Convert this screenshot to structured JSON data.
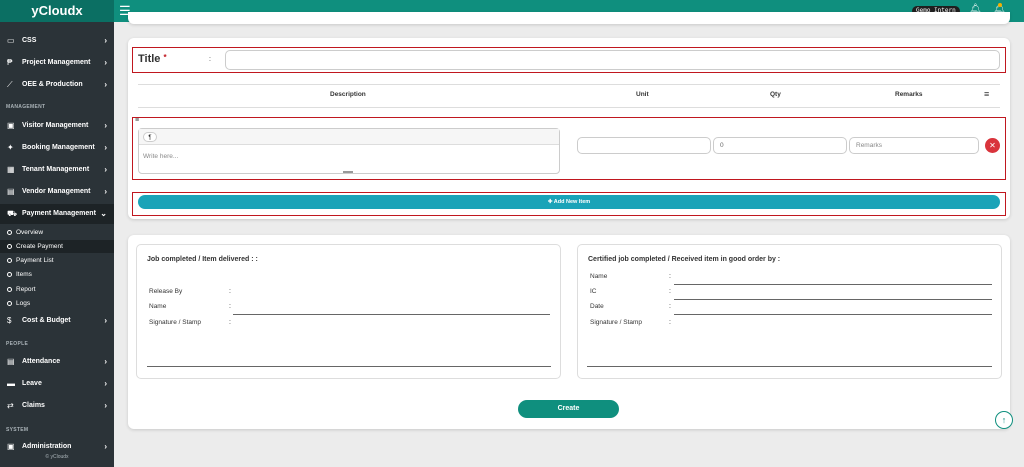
{
  "app": {
    "brand": "yCloudx",
    "user": "Gemo Intern"
  },
  "sidebar": {
    "items_top": [
      {
        "label": "CSS",
        "icon": "▭"
      },
      {
        "label": "Project Management",
        "icon": "₱"
      },
      {
        "label": "OEE & Production",
        "icon": "📈"
      }
    ],
    "section_management": "MANAGEMENT",
    "items_mgmt": [
      {
        "label": "Visitor Management",
        "icon": "▣"
      },
      {
        "label": "Booking Management",
        "icon": "✦"
      },
      {
        "label": "Tenant Management",
        "icon": "▦"
      },
      {
        "label": "Vendor Management",
        "icon": "▤"
      },
      {
        "label": "Payment Management",
        "icon": "🛒"
      }
    ],
    "payment_subitems": [
      "Overview",
      "Create Payment",
      "Payment List",
      "Items",
      "Report",
      "Logs"
    ],
    "cost_budget": {
      "label": "Cost & Budget",
      "icon": "$"
    },
    "section_people": "PEOPLE",
    "items_people": [
      {
        "label": "Attendance",
        "icon": "▤"
      },
      {
        "label": "Leave",
        "icon": "▬"
      },
      {
        "label": "Claims",
        "icon": "⇄"
      }
    ],
    "section_system": "SYSTEM",
    "admin": {
      "label": "Administration",
      "icon": "▣"
    },
    "footer": "© yCloudx"
  },
  "form": {
    "title_label": "Title",
    "required_mark": "*",
    "colon": ":",
    "title_value": ""
  },
  "table": {
    "headers": {
      "description": "Description",
      "unit": "Unit",
      "qty": "Qty",
      "remarks": "Remarks"
    },
    "row": {
      "editor_placeholder": "Write here...",
      "unit_value": "",
      "qty_value": "0",
      "remarks_placeholder": "Remarks"
    },
    "add_label": "Add New Item"
  },
  "signature": {
    "left_heading": "Job completed / Item delivered : :",
    "left_fields": [
      "Release By",
      "Name",
      "Signature / Stamp"
    ],
    "right_heading": "Certified job completed / Received item in good order by :",
    "right_fields": [
      "Name",
      "IC",
      "Date",
      "Signature / Stamp"
    ]
  },
  "create_label": "Create",
  "colors": {
    "brand": "#0f8f7e",
    "sidebar": "#2b3338",
    "add": "#1aa3b8",
    "danger": "#d9343c",
    "highlight": "#c0171f"
  }
}
